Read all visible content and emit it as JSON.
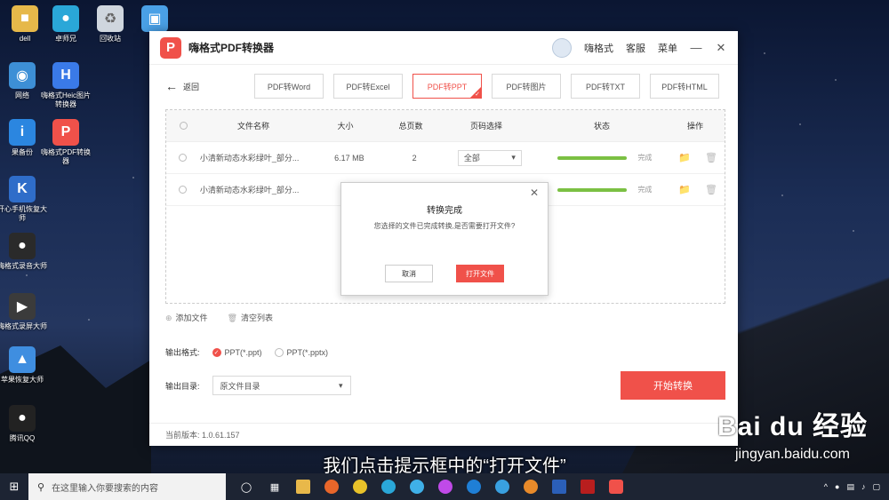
{
  "desktop": {
    "icons": [
      {
        "label": "dell",
        "color": "#e6b84a"
      },
      {
        "label": "卓师兄",
        "color": "#2aa7d8"
      },
      {
        "label": "回收站",
        "color": "#cfd6de"
      },
      {
        "label": "此",
        "color": "#4aa0e6"
      },
      {
        "label": "网络",
        "color": "#3d8fd6"
      },
      {
        "label": "嗨格式Heic图片转换器",
        "color": "#3a7ae8"
      },
      {
        "label": "果备份",
        "color": "#2b86e0"
      },
      {
        "label": "嗨格式PDF转换器",
        "color": "#f0514a"
      },
      {
        "label": "开心手机恢复大师",
        "color": "#2f6dc9"
      },
      {
        "label": "嗨格式录音大师",
        "color": "#2a2a2a"
      },
      {
        "label": "嗨格式录屏大师",
        "color": "#3b3b3b"
      },
      {
        "label": "苹果恢复大师",
        "color": "#3f8ee0"
      },
      {
        "label": "腾讯QQ",
        "color": "#222222"
      }
    ]
  },
  "app": {
    "title": "嗨格式PDF转换器",
    "logo_text": "P",
    "user": "嗨格式",
    "service": "客服",
    "menu": "菜单",
    "back_label": "返回",
    "tabs": [
      "PDF转Word",
      "PDF转Excel",
      "PDF转PPT",
      "PDF转图片",
      "PDF转TXT",
      "PDF转HTML"
    ],
    "active_tab": 2,
    "table": {
      "headers": [
        "文件名称",
        "大小",
        "总页数",
        "页码选择",
        "状态",
        "操作"
      ],
      "rows": [
        {
          "name": "小清新动态水彩绿叶_部分...",
          "size": "6.17 MB",
          "pages": "2",
          "page_sel": "全部",
          "status": "完成",
          "progress": 1.0
        },
        {
          "name": "小清新动态水彩绿叶_部分...",
          "size": "6.",
          "pages": "",
          "page_sel": "",
          "status": "完成",
          "progress": 1.0
        }
      ]
    },
    "dialog": {
      "title": "转换完成",
      "message": "您选择的文件已完成转换,是否需要打开文件?",
      "cancel": "取消",
      "open": "打开文件"
    },
    "add_file": "添加文件",
    "clear_list": "清空列表",
    "output_format_label": "输出格式:",
    "format_options": [
      "PPT(*.ppt)",
      "PPT(*.pptx)"
    ],
    "output_dir_label": "输出目录:",
    "output_dir_value": "原文件目录",
    "start_button": "开始转换",
    "version": "当前版本: 1.0.61.157"
  },
  "subtitle": "我们点击提示框中的“打开文件”",
  "watermark": {
    "brand": "Bai du 经验",
    "url": "jingyan.baidu.com"
  },
  "taskbar": {
    "search_placeholder": "在这里输入你要搜索的内容"
  },
  "accent_color": "#f0514a"
}
